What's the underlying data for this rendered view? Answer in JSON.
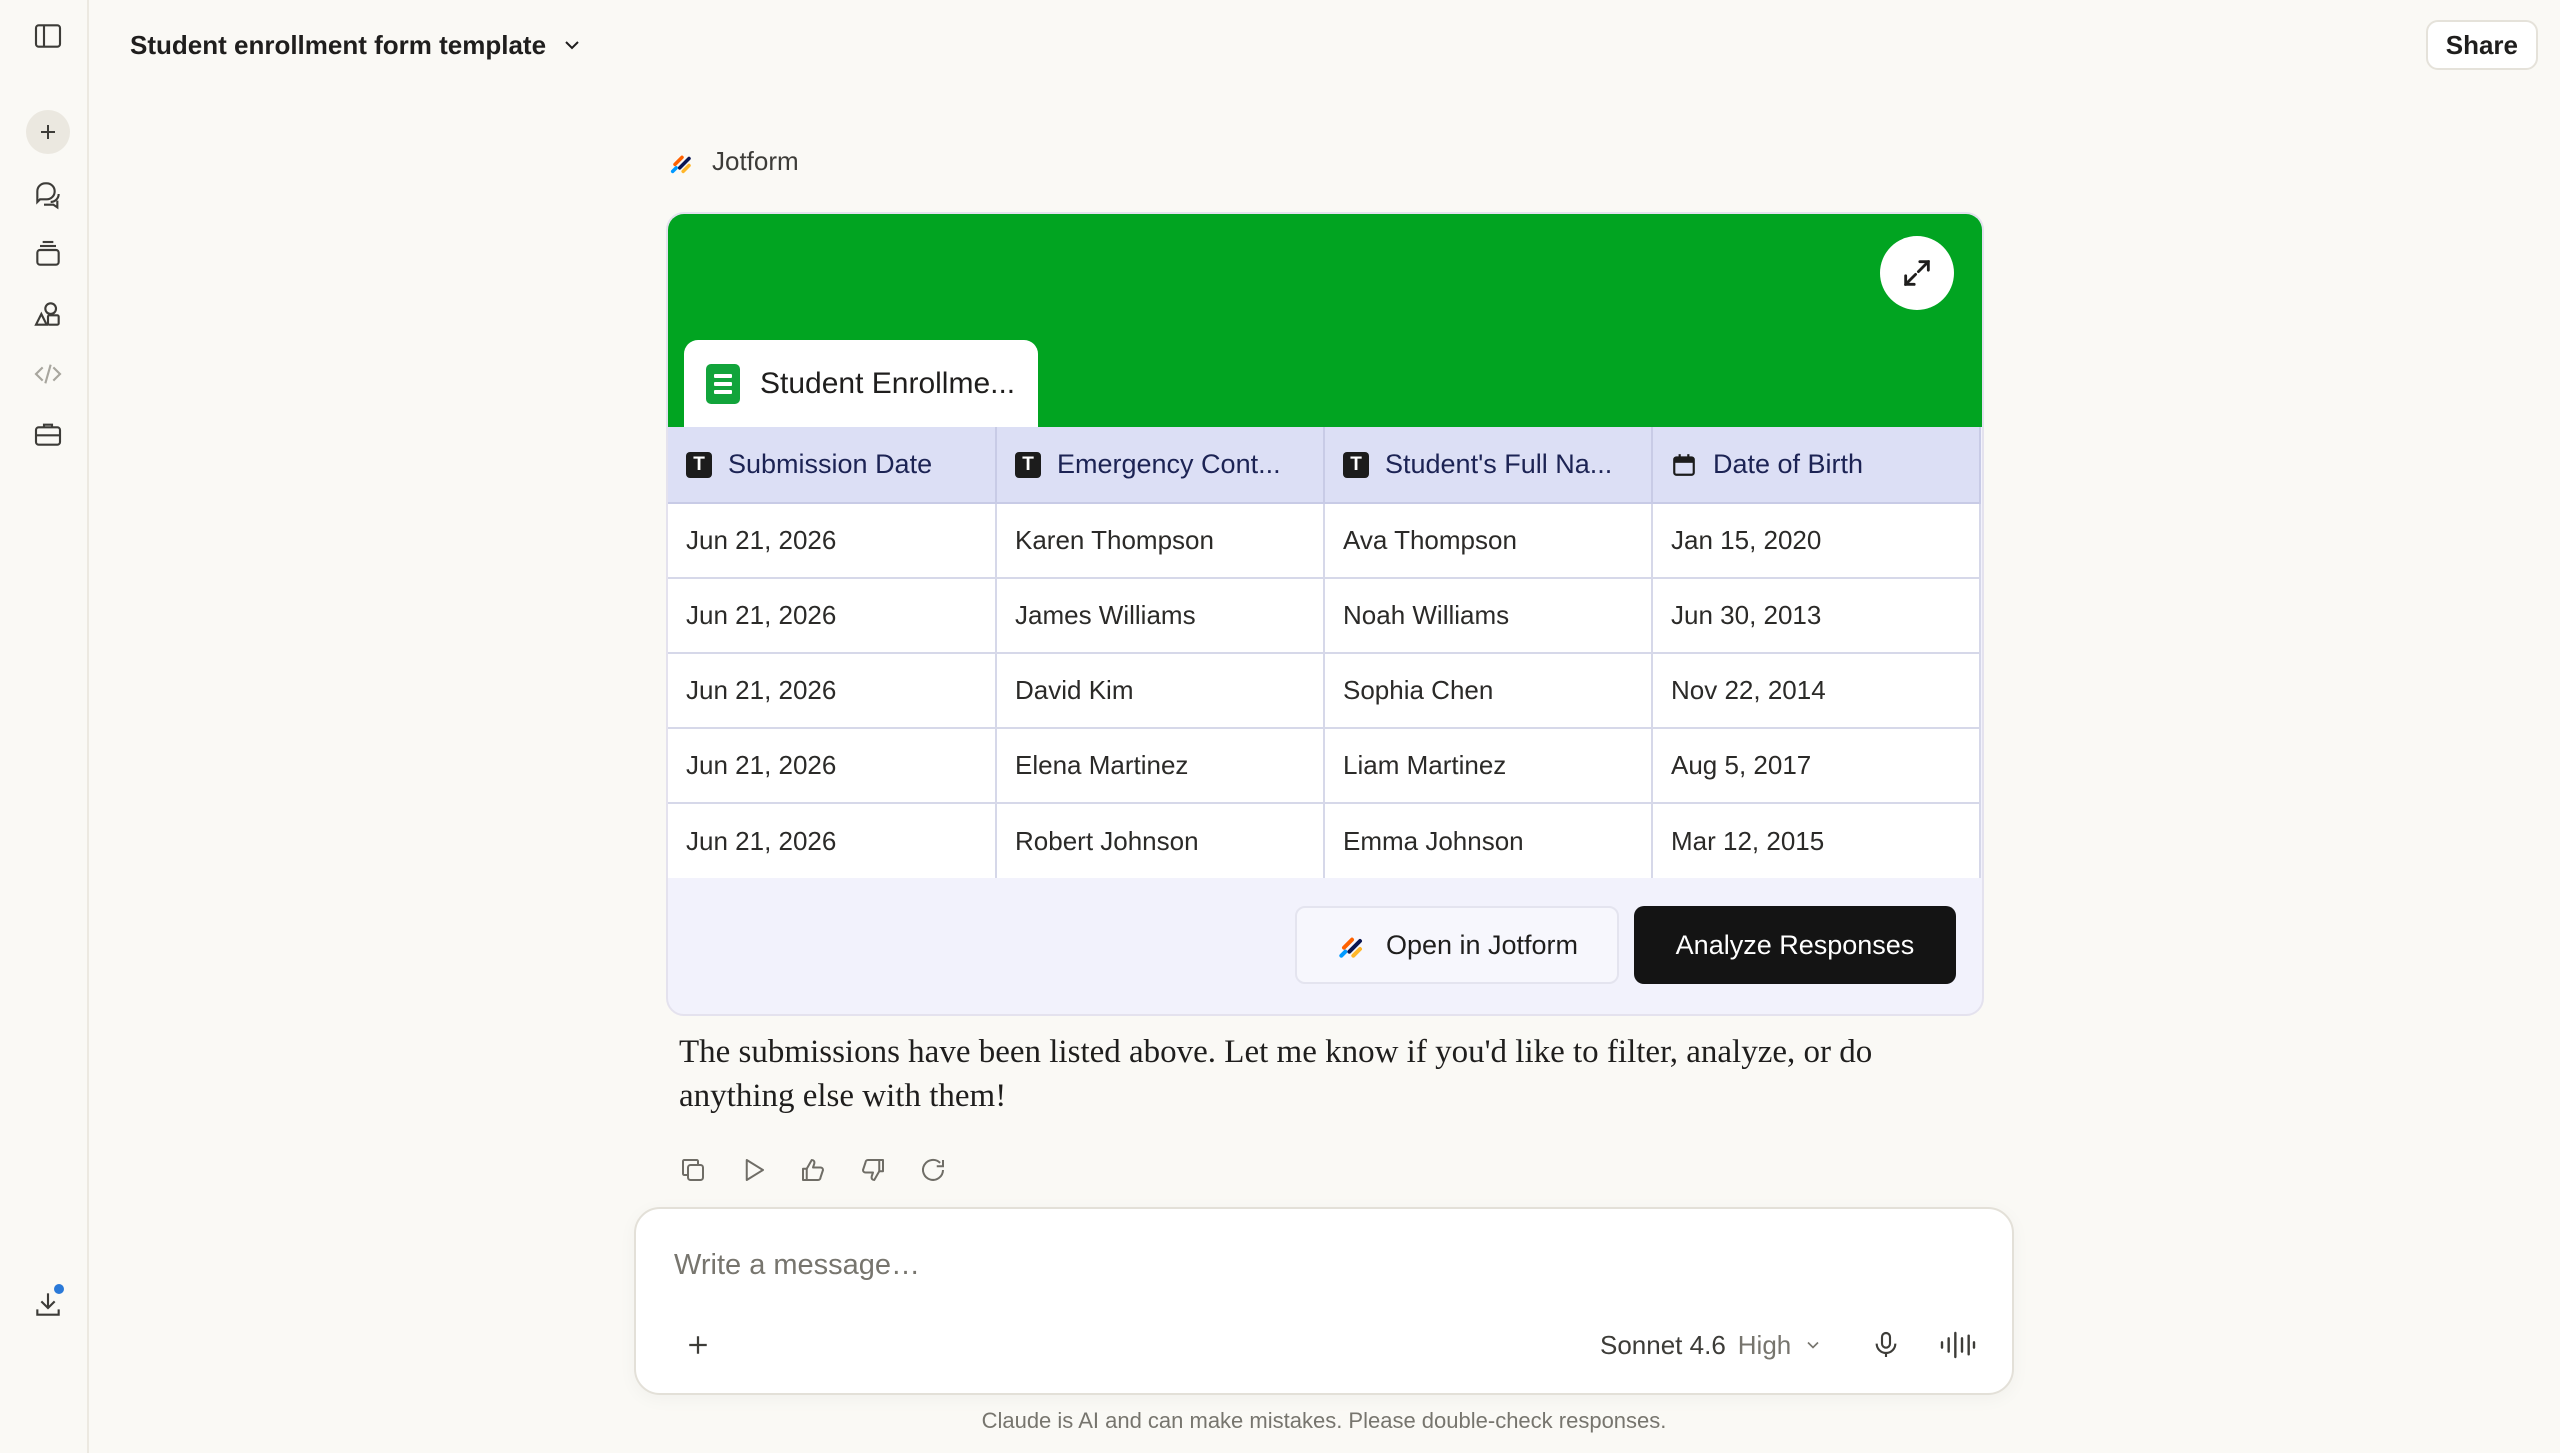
{
  "app": {
    "conversation_title": "Student enrollment form template",
    "share_label": "Share"
  },
  "tool": {
    "name": "Jotform"
  },
  "card": {
    "sheet_tab_title": "Student Enrollme...",
    "header_color": "#01a421",
    "columns": [
      {
        "label": "Submission Date",
        "type": "text"
      },
      {
        "label": "Emergency Cont...",
        "type": "text"
      },
      {
        "label": "Student's Full Na...",
        "type": "text"
      },
      {
        "label": "Date of Birth",
        "type": "date"
      }
    ],
    "rows": [
      [
        "Jun 21, 2026",
        "Karen Thompson",
        "Ava Thompson",
        "Jan 15, 2020"
      ],
      [
        "Jun 21, 2026",
        "James Williams",
        "Noah Williams",
        "Jun 30, 2013"
      ],
      [
        "Jun 21, 2026",
        "David Kim",
        "Sophia Chen",
        "Nov 22, 2014"
      ],
      [
        "Jun 21, 2026",
        "Elena Martinez",
        "Liam Martinez",
        "Aug 5, 2017"
      ],
      [
        "Jun 21, 2026",
        "Robert Johnson",
        "Emma Johnson",
        "Mar 12, 2015"
      ]
    ],
    "open_button": "Open in Jotform",
    "analyze_button": "Analyze Responses"
  },
  "reply": {
    "text": "The submissions have been listed above. Let me know if you'd like to filter, analyze, or do anything else with them!"
  },
  "message_actions": [
    "copy-icon",
    "play-icon",
    "thumbs-up-icon",
    "thumbs-down-icon",
    "retry-icon"
  ],
  "composer": {
    "placeholder": "Write a message…",
    "model": "Sonnet 4.6",
    "effort": "High"
  },
  "footer": {
    "disclaimer": "Claude is AI and can make mistakes. Please double-check responses."
  }
}
